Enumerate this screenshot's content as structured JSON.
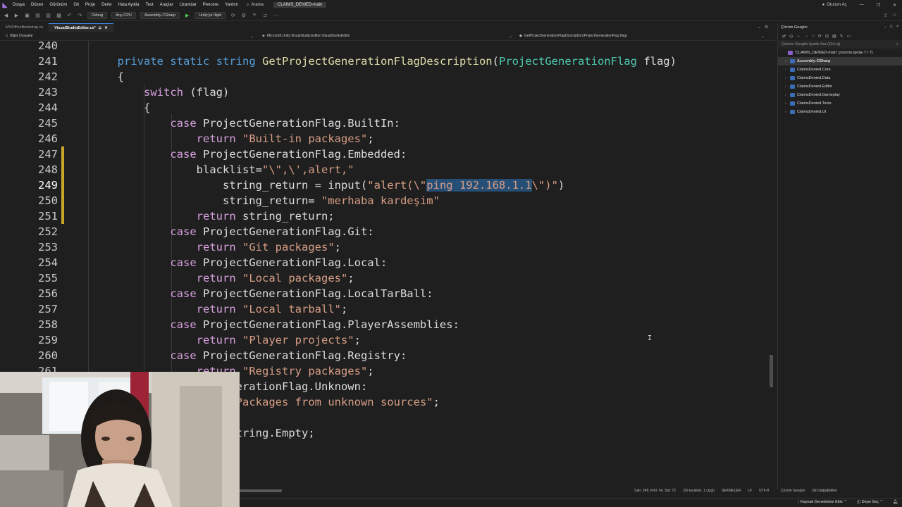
{
  "titlebar": {
    "menu": [
      "Dosya",
      "Düzen",
      "Görünüm",
      "Git",
      "Proje",
      "Derle",
      "Hata Ayıkla",
      "Test",
      "Araçlar",
      "Uzantılar",
      "Pencere",
      "Yardım"
    ],
    "search_label": "Arama",
    "solution_name": "CLAIMS_DENIED-main",
    "user_label": "Oturum Aç"
  },
  "toolbar": {
    "config": "Debug",
    "platform": "Any CPU",
    "project": "Assembly-CSharp",
    "run_target": "Unity'ye İliştir"
  },
  "tabs": {
    "items": [
      "MVOfficeBootstrap.cs",
      "VisualStudioEditor.cs*"
    ],
    "active_index": 1
  },
  "navbar": {
    "project": "Diğer Dosyalar",
    "namespace": "Microsoft.Unity.VisualStudio.Editor.VisualStudioEditor",
    "member": "GetProjectGenerationFlagDescription(ProjectGenerationFlag flag)"
  },
  "editor": {
    "current_line": 249,
    "lines": [
      {
        "n": "240",
        "tokens": []
      },
      {
        "n": "241",
        "tokens": [
          {
            "t": "private",
            "c": "kw"
          },
          {
            "t": " "
          },
          {
            "t": "static",
            "c": "kw"
          },
          {
            "t": " "
          },
          {
            "t": "string",
            "c": "kw"
          },
          {
            "t": " "
          },
          {
            "t": "GetProjectGenerationFlagDescription",
            "c": "fn"
          },
          {
            "t": "("
          },
          {
            "t": "ProjectGenerationFlag",
            "c": "typ"
          },
          {
            "t": " "
          },
          {
            "t": "flag",
            "c": "txt"
          },
          {
            "t": ")"
          }
        ]
      },
      {
        "n": "242",
        "tokens": [
          {
            "t": "{"
          }
        ]
      },
      {
        "n": "243",
        "tokens": [
          {
            "t": "    "
          },
          {
            "t": "switch",
            "c": "ctl"
          },
          {
            "t": " (flag)"
          }
        ]
      },
      {
        "n": "244",
        "tokens": [
          {
            "t": "    {"
          }
        ]
      },
      {
        "n": "245",
        "tokens": [
          {
            "t": "        "
          },
          {
            "t": "case",
            "c": "ctl"
          },
          {
            "t": " ProjectGenerationFlag.BuiltIn:"
          }
        ]
      },
      {
        "n": "246",
        "tokens": [
          {
            "t": "            "
          },
          {
            "t": "return",
            "c": "ctl"
          },
          {
            "t": " "
          },
          {
            "t": "\"Built-in packages\"",
            "c": "str"
          },
          {
            "t": ";"
          }
        ]
      },
      {
        "n": "247",
        "tokens": [
          {
            "t": "        "
          },
          {
            "t": "case",
            "c": "ctl"
          },
          {
            "t": " ProjectGenerationFlag.Embedded:"
          }
        ]
      },
      {
        "n": "248",
        "tokens": [
          {
            "t": "            blacklist="
          },
          {
            "t": "\"\\\",\\',alert,\"",
            "c": "str"
          }
        ]
      },
      {
        "n": "249",
        "tokens": [
          {
            "t": "                string_return = input("
          },
          {
            "t": "\"alert(\\\"",
            "c": "str"
          },
          {
            "t": "ping 192.168.1.1",
            "c": "str sel"
          },
          {
            "t": "\\\")\"",
            "c": "str"
          },
          {
            "t": ")"
          }
        ]
      },
      {
        "n": "250",
        "tokens": [
          {
            "t": "                string_return= "
          },
          {
            "t": "\"merhaba kardeşim\"",
            "c": "str"
          }
        ]
      },
      {
        "n": "251",
        "tokens": [
          {
            "t": "            "
          },
          {
            "t": "return",
            "c": "ctl"
          },
          {
            "t": " string_return;"
          }
        ]
      },
      {
        "n": "252",
        "tokens": [
          {
            "t": "        "
          },
          {
            "t": "case",
            "c": "ctl"
          },
          {
            "t": " ProjectGenerationFlag.Git:"
          }
        ]
      },
      {
        "n": "253",
        "tokens": [
          {
            "t": "            "
          },
          {
            "t": "return",
            "c": "ctl"
          },
          {
            "t": " "
          },
          {
            "t": "\"Git packages\"",
            "c": "str"
          },
          {
            "t": ";"
          }
        ]
      },
      {
        "n": "254",
        "tokens": [
          {
            "t": "        "
          },
          {
            "t": "case",
            "c": "ctl"
          },
          {
            "t": " ProjectGenerationFlag.Local:"
          }
        ]
      },
      {
        "n": "255",
        "tokens": [
          {
            "t": "            "
          },
          {
            "t": "return",
            "c": "ctl"
          },
          {
            "t": " "
          },
          {
            "t": "\"Local packages\"",
            "c": "str"
          },
          {
            "t": ";"
          }
        ]
      },
      {
        "n": "256",
        "tokens": [
          {
            "t": "        "
          },
          {
            "t": "case",
            "c": "ctl"
          },
          {
            "t": " ProjectGenerationFlag.LocalTarBall:"
          }
        ]
      },
      {
        "n": "257",
        "tokens": [
          {
            "t": "            "
          },
          {
            "t": "return",
            "c": "ctl"
          },
          {
            "t": " "
          },
          {
            "t": "\"Local tarball\"",
            "c": "str"
          },
          {
            "t": ";"
          }
        ]
      },
      {
        "n": "258",
        "tokens": [
          {
            "t": "        "
          },
          {
            "t": "case",
            "c": "ctl"
          },
          {
            "t": " ProjectGenerationFlag.PlayerAssemblies:"
          }
        ]
      },
      {
        "n": "259",
        "tokens": [
          {
            "t": "            "
          },
          {
            "t": "return",
            "c": "ctl"
          },
          {
            "t": " "
          },
          {
            "t": "\"Player projects\"",
            "c": "str"
          },
          {
            "t": ";"
          }
        ]
      },
      {
        "n": "260",
        "tokens": [
          {
            "t": "        "
          },
          {
            "t": "case",
            "c": "ctl"
          },
          {
            "t": " ProjectGenerationFlag.Registry:"
          }
        ]
      },
      {
        "n": "261",
        "tokens": [
          {
            "t": "            "
          },
          {
            "t": "return",
            "c": "ctl"
          },
          {
            "t": " "
          },
          {
            "t": "\"Registry packages\"",
            "c": "str"
          },
          {
            "t": ";"
          }
        ]
      },
      {
        "n": "",
        "tokens": [
          {
            "t": "         rojectGenerationFlag.Unknown:"
          }
        ]
      },
      {
        "n": "",
        "tokens": [
          {
            "t": "          "
          },
          {
            "t": "return",
            "c": "ctl"
          },
          {
            "t": " "
          },
          {
            "t": "\"Packages from unknown sources\"",
            "c": "str"
          },
          {
            "t": ";"
          }
        ]
      },
      {
        "n": "",
        "tokens": [
          {
            "t": "         t:"
          }
        ]
      },
      {
        "n": "",
        "tokens": [
          {
            "t": "          "
          },
          {
            "t": "return",
            "c": "ctl"
          },
          {
            "t": " string.Empty;"
          }
        ]
      }
    ]
  },
  "editor_status": {
    "position": "Satr: 249, Krkt: 54, Süt: 72",
    "selection": "(16 karakter, 1 çizgi)",
    "indent": "SEKMELER",
    "eol": "LF",
    "encoding": "UTF-8"
  },
  "solution_explorer": {
    "title": "Çözüm Gezgini",
    "search_placeholder": "Çözüm Gezgini İçinde Ara (Ctrl+ş)",
    "solution_label": "'CLAIMS_DENIED-main' çözümü (proje 7 / 7)",
    "projects": [
      "Assembly-CSharp",
      "ClaimsDenied.Core",
      "ClaimsDenied.Data",
      "ClaimsDenied.Editor",
      "ClaimsDenied.Gameplay",
      "ClaimsDenied.Tests",
      "ClaimsDenied.UI"
    ],
    "selected_index": 0,
    "bottom_tabs": [
      "Çözüm Gezgini",
      "Git Değişiklikleri"
    ]
  },
  "statusbar": {
    "source_control": "Kaynak Denetimine Ekle",
    "repo": "Depo Seç"
  }
}
